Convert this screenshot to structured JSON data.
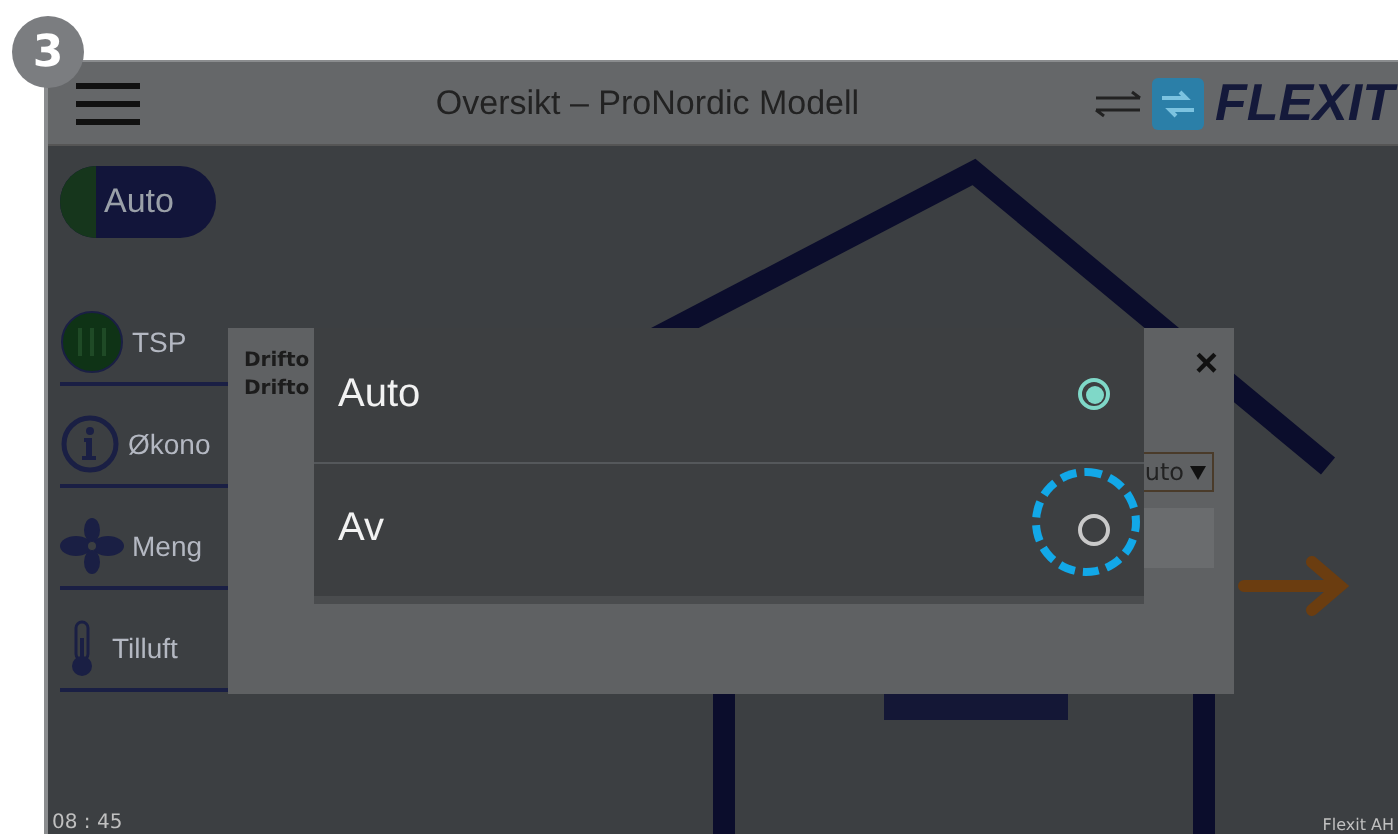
{
  "step_badge": "3",
  "header": {
    "title": "Oversikt – ProNordic Modell",
    "logo_text": "FLEXIT"
  },
  "mode_toggle": {
    "label": "Auto",
    "on": true
  },
  "sidebar": {
    "items": [
      {
        "label": "TSP",
        "kind": "tsp"
      },
      {
        "label": "Økono",
        "kind": "info"
      },
      {
        "label": "Meng",
        "kind": "fan"
      },
      {
        "label": "Tilluft",
        "kind": "thermo"
      }
    ]
  },
  "clock": "08 : 45",
  "footer_text": "Flexit AH",
  "back_dialog": {
    "labels": [
      "Drifto",
      "Drifto"
    ],
    "close": "×",
    "select_value": "uto"
  },
  "options": [
    {
      "label": "Auto",
      "selected": true,
      "highlighted": false
    },
    {
      "label": "Av",
      "selected": false,
      "highlighted": true
    }
  ]
}
